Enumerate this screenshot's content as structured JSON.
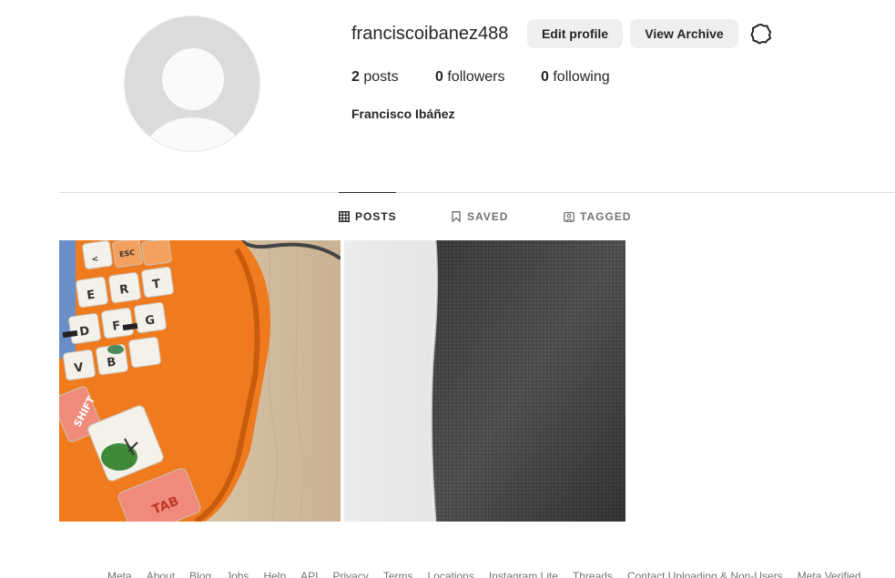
{
  "profile": {
    "username": "franciscoibanez488",
    "full_name": "Francisco Ibáñez",
    "avatar_icon": "default-avatar-icon"
  },
  "actions": {
    "edit_profile": "Edit profile",
    "view_archive": "View Archive",
    "settings_icon": "gear-icon"
  },
  "stats": {
    "posts_count": "2",
    "posts_label": "posts",
    "followers_count": "0",
    "followers_label": "followers",
    "following_count": "0",
    "following_label": "following"
  },
  "tabs": [
    {
      "label": "POSTS",
      "icon": "grid-icon",
      "active": true
    },
    {
      "label": "SAVED",
      "icon": "bookmark-icon",
      "active": false
    },
    {
      "label": "TAGGED",
      "icon": "tag-person-icon",
      "active": false
    }
  ],
  "posts": [
    {
      "subject": "keyboard",
      "keys": [
        "ESC",
        "<",
        "E",
        "R",
        "T",
        "D",
        "F",
        "G",
        "V",
        "B",
        "SHIFT",
        "TAB"
      ]
    },
    {
      "subject": "fabric"
    }
  ],
  "footer": {
    "links": [
      "Meta",
      "About",
      "Blog",
      "Jobs",
      "Help",
      "API",
      "Privacy",
      "Terms",
      "Locations",
      "Instagram Lite",
      "Threads",
      "Contact Uploading & Non-Users",
      "Meta Verified"
    ]
  },
  "colors": {
    "text_primary": "#262626",
    "text_secondary": "#737373",
    "button_bg": "#efefef",
    "divider": "#dbdbdb",
    "keyboard_case": "#f07a1e"
  }
}
